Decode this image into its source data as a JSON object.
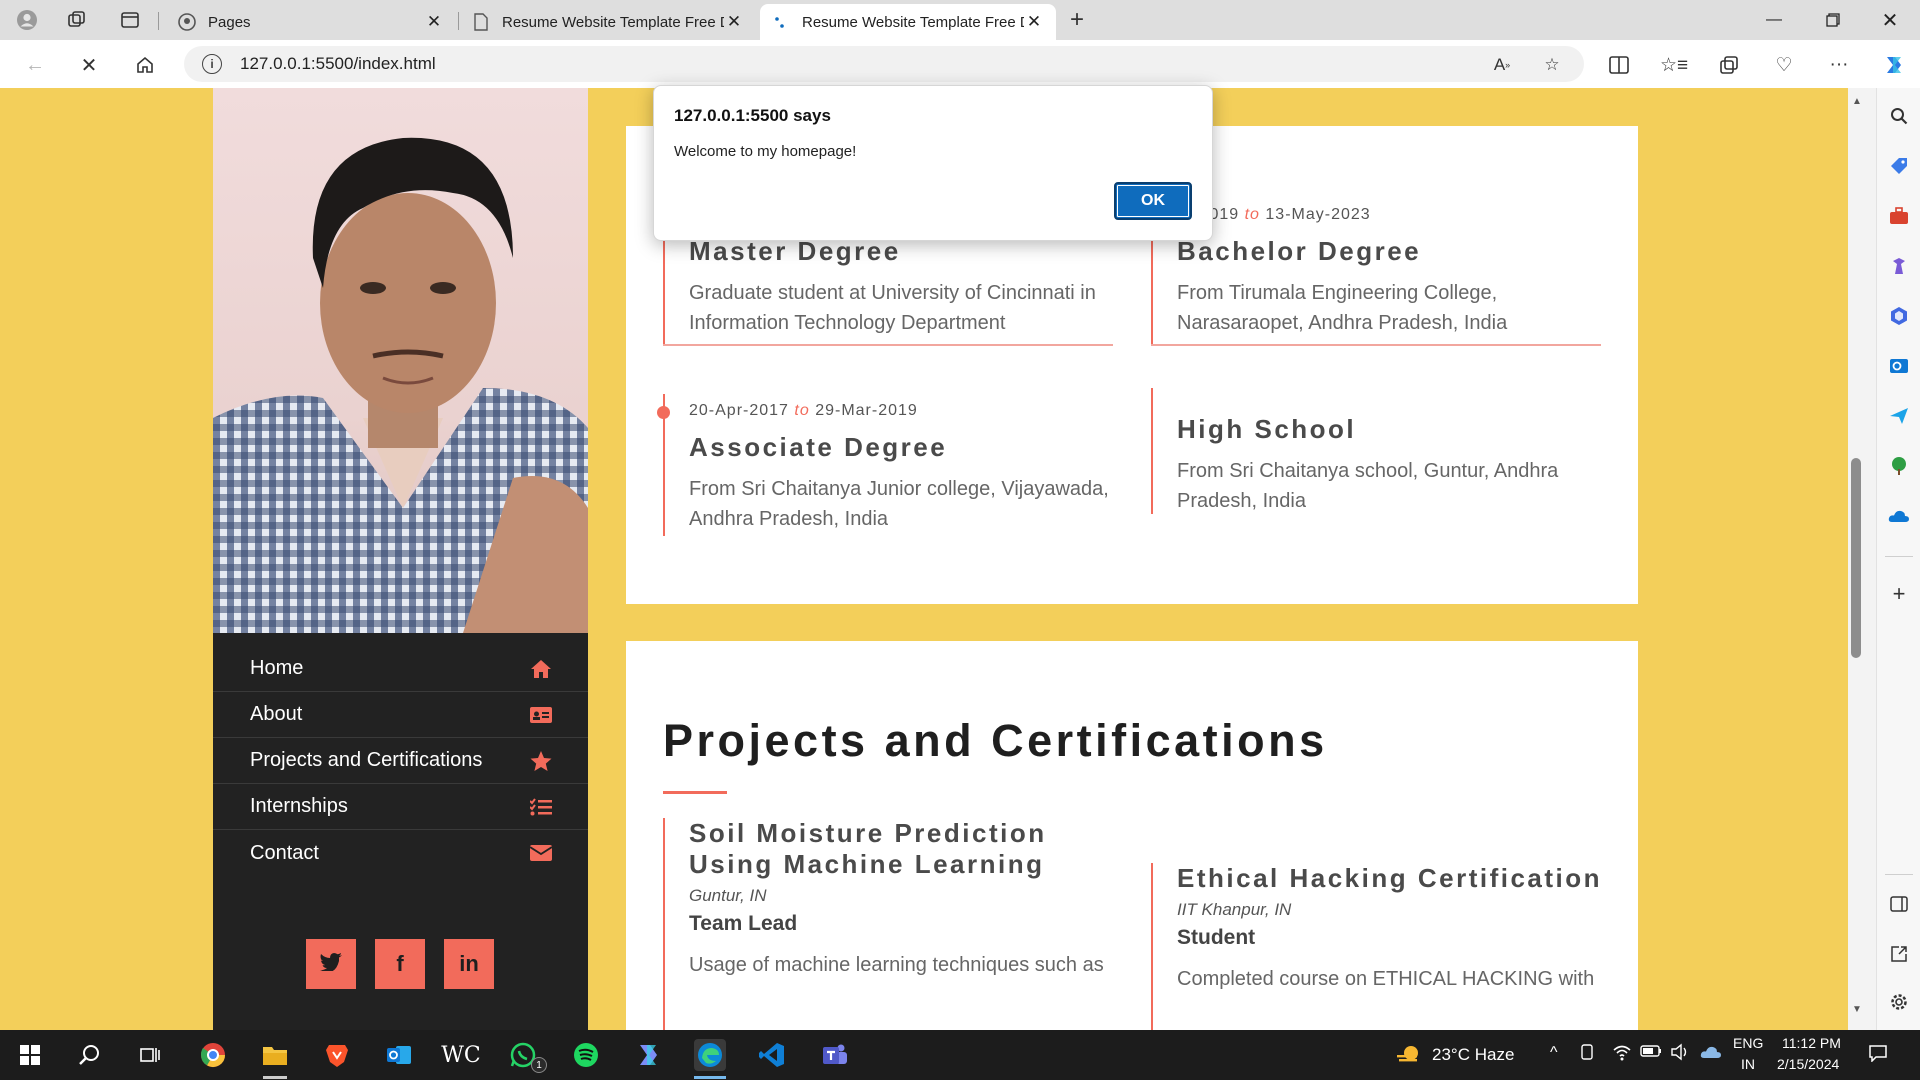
{
  "browser": {
    "tabs": [
      {
        "label": "Pages",
        "icon": "github-icon"
      },
      {
        "label": "Resume Website Template Free D",
        "icon": "page-icon"
      },
      {
        "label": "Resume Website Template Free D",
        "icon": "loading-icon",
        "active": true
      }
    ],
    "url": "127.0.0.1:5500/index.html"
  },
  "alert": {
    "title": "127.0.0.1:5500 says",
    "message": "Welcome to my homepage!",
    "ok_label": "OK"
  },
  "sidebar": {
    "menu": [
      {
        "label": "Home",
        "icon": "home-icon"
      },
      {
        "label": "About",
        "icon": "id-card-icon"
      },
      {
        "label": "Projects and Certifications",
        "icon": "star-icon"
      },
      {
        "label": "Internships",
        "icon": "checklist-icon"
      },
      {
        "label": "Contact",
        "icon": "envelope-icon"
      }
    ],
    "social": [
      {
        "label": "twitter",
        "icon": "twitter-icon"
      },
      {
        "label": "facebook",
        "icon": "facebook-icon"
      },
      {
        "label": "linkedin",
        "icon": "linkedin-icon"
      }
    ]
  },
  "education": [
    {
      "title": "Master Degree",
      "desc": "Graduate student at University of Cincinnati in Information Technology Department"
    },
    {
      "date_start": "pr-2019",
      "date_sep": "to",
      "date_end": "13-May-2023",
      "title": "Bachelor Degree",
      "desc": "From Tirumala Engineering College, Narasaraopet, Andhra Pradesh, India"
    },
    {
      "date_start": "20-Apr-2017",
      "date_sep": "to",
      "date_end": "29-Mar-2019",
      "title": "Associate Degree",
      "desc": "From Sri Chaitanya Junior college, Vijayawada, Andhra Pradesh, India"
    },
    {
      "title": "High School",
      "desc": "From Sri Chaitanya school, Guntur, Andhra Pradesh, India"
    }
  ],
  "projects": {
    "heading": "Projects and Certifications",
    "items": [
      {
        "title_line1": "Soil Moisture Prediction",
        "title_line2": "Using Machine Learning",
        "location": "Guntur, IN",
        "role": "Team Lead",
        "desc": "Usage of machine learning techniques such as"
      },
      {
        "title": "Ethical Hacking Certification",
        "location": "IIT Khanpur, IN",
        "role": "Student",
        "desc": "Completed course on ETHICAL HACKING with"
      }
    ]
  },
  "taskbar": {
    "weather": "23°C  Haze",
    "lang_top": "ENG",
    "lang_bottom": "IN",
    "time": "11:12 PM",
    "date": "2/15/2024",
    "whatsapp_badge": "1"
  },
  "colors": {
    "accent": "#f26b5b",
    "page_bg": "#f3cf5a",
    "sidebar_bg": "#222222"
  }
}
